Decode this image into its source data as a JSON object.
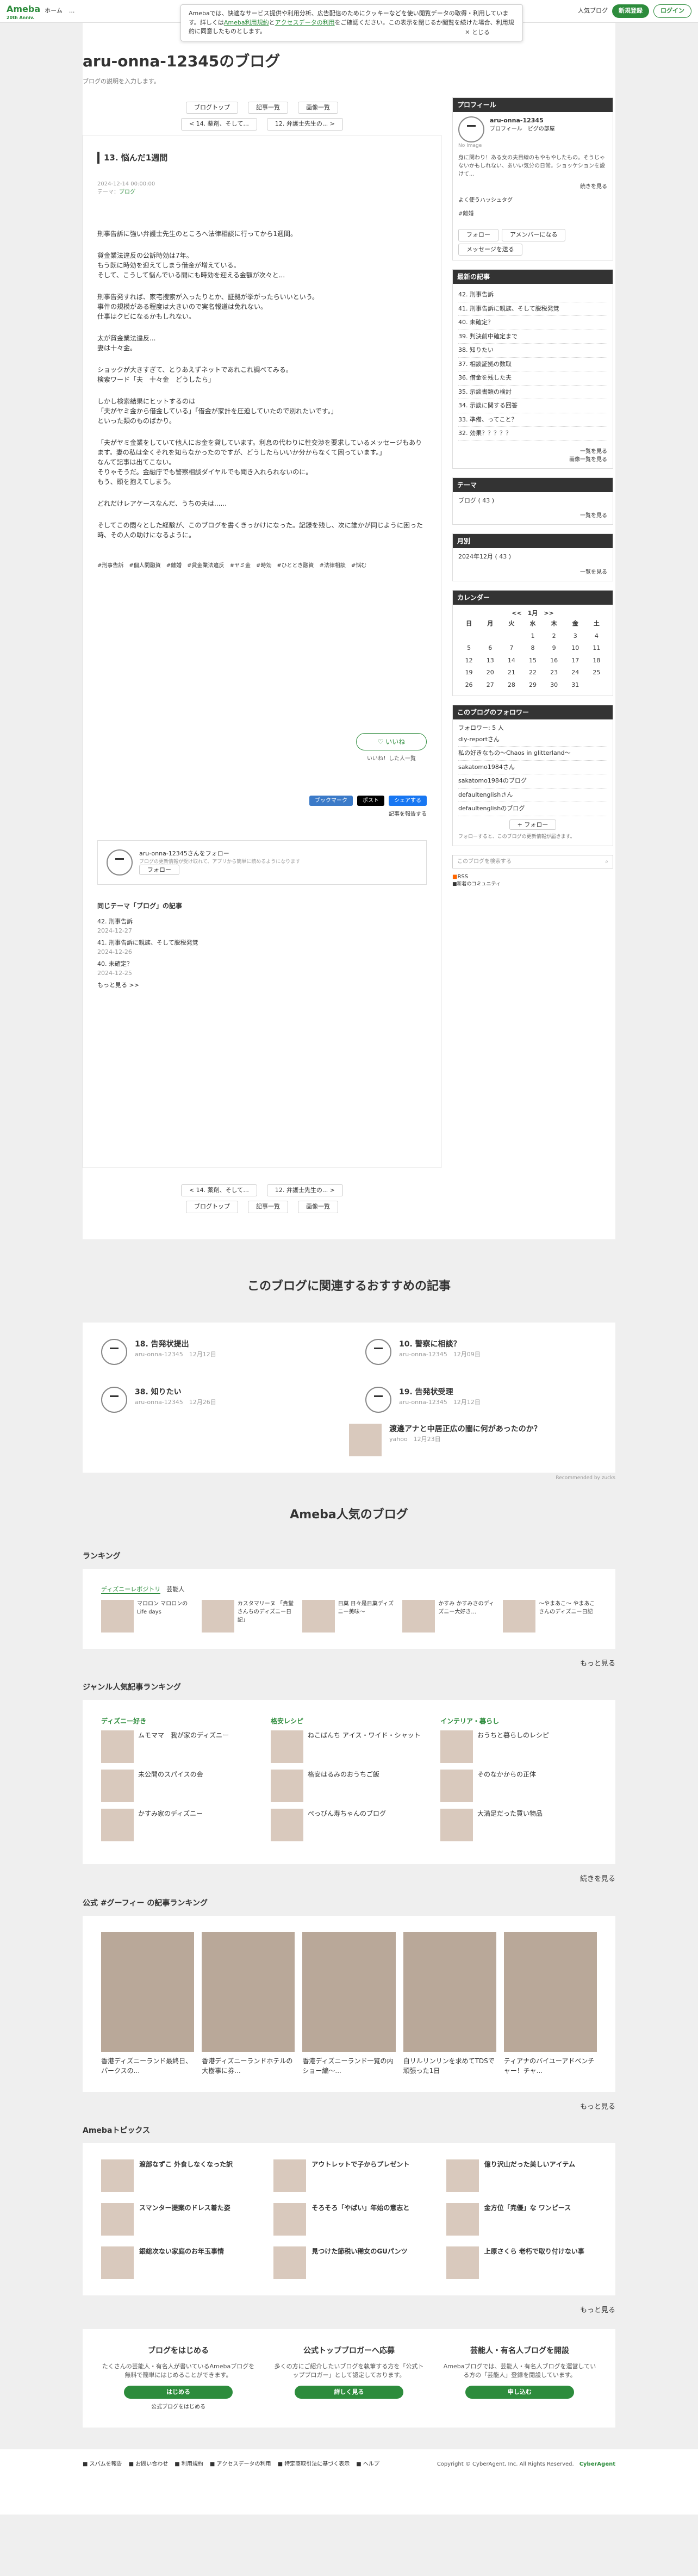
{
  "header": {
    "logo": "Ameba",
    "logo_sub": "20th Anniv.",
    "nav": [
      "ホーム",
      "..."
    ],
    "popular": "人気ブログ",
    "signup": "新規登録",
    "login": "ログイン"
  },
  "cookie": {
    "text": "Amebaでは、快適なサービス提供や利用分析、広告配信のためにクッキーなどを使い閲覧データの取得・利用しています。詳しくは",
    "link1": "Ameba利用規約",
    "and": "と",
    "link2": "アクセスデータの利用",
    "rest": "をご確認ください。この表示を閉じるか閲覧を続けた場合、利用規約に同意したものとします。",
    "close": "とじる"
  },
  "blog": {
    "title": "aru-onna-12345のブログ",
    "desc": "ブログの説明を入力します。"
  },
  "pager": {
    "top": "ブログトップ",
    "list": "記事一覧",
    "images": "画像一覧",
    "prev": "< 14. 薬剤、そして...",
    "next": "12. 弁護士先生の... >"
  },
  "article": {
    "title": "13. 悩んだ1週間",
    "date": "2024-12-14 00:00:00",
    "theme_label": "テーマ：",
    "theme": "ブログ",
    "paragraphs": [
      "刑事告訴に強い弁護士先生のところへ法律相談に行ってから1週間。",
      "貸金業法違反の公訴時効は7年。\nもう既に時効を迎えてしまう借金が増えている。\nそして、こうして悩んでいる間にも時効を迎える金額が次々と...",
      "刑事告発すれば、家宅捜索が入ったりとか、証拠が挙がったらいいという。\n事件の規模がある程度は大きいので実名報道は免れない。\n仕事はクビになるかもしれない。",
      "太が貸金業法違反...\n妻は十々金。",
      "ショックが大きすぎて、とりあえずネットであれこれ調べてみる。\n検索ワード「夫　十々金　どうしたら」",
      "しかし検索結果にヒットするのは\n「夫がヤミ金から借金している」「借金が家計を圧迫していたので別れたいです。」\nといった類のものばかり。",
      "「夫がヤミ金業をしていて他人にお金を貸しています。利息の代わりに性交渉を要求しているメッセージもあります。妻の私は全くそれを知らなかったのですが、どうしたらいいか分からなくて困っています。」\nなんて記事は出てこない。\nそりゃそうだ。金融庁でも警察相談ダイヤルでも聞き入れられないのに。\nもう、頭を抱えてしまう。",
      "どれだけレアケースなんだ、うちの夫は......",
      "そしてこの悶々とした経験が、このブログを書くきっかけになった。記録を残し、次に誰かが同じように困った時、その人の助けになるように。"
    ],
    "tags": [
      "#刑事告訴",
      "#個人間融資",
      "#離婚",
      "#貸金業法違反",
      "#ヤミ金",
      "#時効",
      "#ひととき融資",
      "#法律相談",
      "#悩む"
    ],
    "like": "いいね",
    "like_list": "いいね！した人一覧",
    "bookmark": "ブックマーク",
    "post": "ポスト",
    "share": "シェアする",
    "report": "記事を報告する",
    "follow_text": "aru-onna-12345さんをフォロー",
    "follow_sub": "ブログの更新情報が受け取れて、アプリから簡単に読めるようになります",
    "follow_btn": "フォロー",
    "same_theme": "同じテーマ「ブログ」の記事",
    "related": [
      {
        "t": "42. 刑事告訴",
        "d": "2024-12-27"
      },
      {
        "t": "41. 刑事告訴に親族、そして脱税発覚",
        "d": "2024-12-26"
      },
      {
        "t": "40. 未確定？",
        "d": "2024-12-25"
      }
    ],
    "more": "もっと見る >>"
  },
  "side": {
    "profile_h": "プロフィール",
    "name": "aru-onna-12345",
    "profile_links": "プロフィール　ピグの部屋",
    "no_image": "No Image",
    "bio": "身に関わり！ある女の夫目線のもやもやしたもの。そうじゃないかもしれない、あいい気分の日常。ショッケションを設けて...",
    "more": "続きを見る",
    "hashtags_label": "よく使うハッシュタグ",
    "hashtag": "#離婚",
    "follow": "フォロー",
    "amember": "アメンバーになる",
    "message": "メッセージを送る",
    "recent_h": "最新の記事",
    "recent": [
      "42. 刑事告訴",
      "41. 刑事告訴に親族、そして脱税発覚",
      "40. 未確定？",
      "39. 判決前中確定まで",
      "38. 知りたい",
      "37. 相談証拠の数取",
      "36. 借金を残した夫",
      "35. 示談書類の検討",
      "34. 示談に関する回答",
      "33. 準備、ってこと？",
      "32. 効果？？？？？"
    ],
    "list_more": "一覧を見る",
    "images_list": "画像一覧を見る",
    "theme_h": "テーマ",
    "theme_item": "ブログ ( 43 )",
    "month_h": "月別",
    "month_item": "2024年12月 ( 43 )",
    "cal_h": "カレンダー",
    "cal_month": "1月",
    "cal_prev": "<<",
    "cal_next": ">>",
    "cal_days": [
      "日",
      "月",
      "火",
      "水",
      "木",
      "金",
      "土"
    ],
    "cal_rows": [
      [
        "",
        "",
        "",
        "1",
        "2",
        "3",
        "4"
      ],
      [
        "5",
        "6",
        "7",
        "8",
        "9",
        "10",
        "11"
      ],
      [
        "12",
        "13",
        "14",
        "15",
        "16",
        "17",
        "18"
      ],
      [
        "19",
        "20",
        "21",
        "22",
        "23",
        "24",
        "25"
      ],
      [
        "26",
        "27",
        "28",
        "29",
        "30",
        "31",
        ""
      ]
    ],
    "followers_h": "このブログのフォロワー",
    "followers_count": "フォロワー: 5 人",
    "followers": [
      "diy-reportさん",
      "私の好きなもの〜Chaos in glitterland〜",
      "sakatomo1984さん",
      "sakatomo1984のブログ",
      "defaultenglishさん",
      "defaultenglishのブログ"
    ],
    "followers_note": "フォローすると、このブログの更新情報が届きます。",
    "search": "このブログを検索する",
    "rss": "RSS",
    "rss_sub": "■新着のコミュニティ"
  },
  "recs": {
    "title": "このブログに関連するおすすめの記事",
    "items": [
      {
        "t": "18. 告発状提出",
        "m": "aru-onna-12345　12月12日"
      },
      {
        "t": "10. 警察に相談？",
        "m": "aru-onna-12345　12月09日"
      },
      {
        "t": "38. 知りたい",
        "m": "aru-onna-12345　12月26日"
      },
      {
        "t": "19. 告発状受理",
        "m": "aru-onna-12345　12月12日"
      }
    ],
    "extra": {
      "t": "渡邊アナと中居正広の闇に何があったのか？",
      "m": "yahoo　12月23日"
    },
    "powered": "Recommended by zucks"
  },
  "popular": {
    "title": "Ameba人気のブログ",
    "ranking_h": "ランキング",
    "tab1": "ディズニーレポジトリ",
    "tab2": "芸能人",
    "ranks": [
      "マロロン マロロンのLife days",
      "カスタマリーヌ 「貴堂さんちのディズニー日記」",
      "日菓 日々是日菓ディズニー美味〜",
      "かすみ かすみさのディズニー大好き...",
      "〜やまあこ〜 やまあこさんのディズニー日記"
    ],
    "more": "もっと見る",
    "genre_h": "ジャンル人気記事ランキング",
    "genres": [
      {
        "h": "ディズニー好き",
        "items": [
          "ムモママ　我が家のディズニー",
          "未公開のスパイスの会",
          "かすみ家のディズニー"
        ]
      },
      {
        "h": "格安レシピ",
        "items": [
          "ねこぱんち アイス・ワイド・シャット",
          "格安はるみのおうちご飯",
          "ぺっぴん寿ちゃんのブログ"
        ]
      },
      {
        "h": "インテリア・暮らし",
        "items": [
          "おうちと暮らしのレシピ",
          "そのなかからの正体",
          "大満足だった買い物品"
        ]
      }
    ],
    "genre_more": "続きを見る",
    "official_h": "公式 #グーフィー の記事ランキング",
    "photos": [
      "香港ディズニーランド最終日、パークスの...",
      "香港ディズニーランドホテルの大樹事に券...",
      "香港ディズニーランド一覧の内ショー編〜...",
      "白リルリンリンを求めてTDSで頑張った1日",
      "ティアナのバイユーアドベンチャー！チャ..."
    ],
    "topics_h": "Amebaトピックス",
    "topics": [
      "渡部なずこ 外食しなくなった訳",
      "アウトレットで子からプレゼント",
      "億り沢山だった美しいアイテム",
      "スマンター提案のドレス着た姿",
      "そろそろ「やばい」年始の意志と",
      "金方位「尭優」な ワンピース",
      "銀総次ない家庭のお年玉事情",
      "見つけた節税い稀女のGUパンツ",
      "上原さくら 老朽で取り付けない事"
    ]
  },
  "cta": [
    {
      "h": "ブログをはじめる",
      "p": "たくさんの芸能人・有名人が書いているAmebaブログを無料で簡単にはじめることができます。",
      "b": "はじめる",
      "s": "公式ブログをはじめる"
    },
    {
      "h": "公式トップブロガーへ応募",
      "p": "多くの方にご紹介したいブログを執筆する方を「公式トップブロガー」として認定しております。",
      "b": "詳しく見る"
    },
    {
      "h": "芸能人・有名人ブログを開設",
      "p": "Amebaブログでは、芸能人・有名人ブログを運営している方の「芸能人」登録を開設しています。",
      "b": "申し込む"
    }
  ],
  "footer": {
    "links": [
      "スパムを報告",
      "お問い合わせ",
      "利用規約",
      "アクセスデータの利用",
      "特定商取引法に基づく表示",
      "ヘルプ"
    ],
    "copy": "Copyright © CyberAgent, Inc. All Rights Reserved.",
    "brand": "CyberAgent"
  },
  "colors": {
    "accent": "#2d8c3c",
    "dark": "#333333"
  }
}
